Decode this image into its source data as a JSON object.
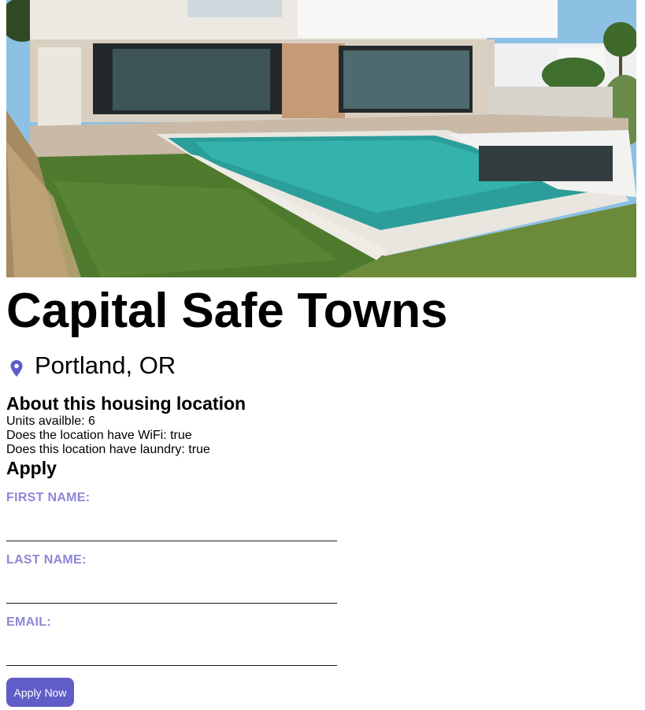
{
  "listing": {
    "name": "Capital Safe Towns",
    "city_state": "Portland, OR",
    "photo_icon": "house-photo"
  },
  "about": {
    "heading": "About this housing location",
    "units": "Units availble: 6",
    "wifi": "Does the location have WiFi: true",
    "laundry": "Does this location have laundry: true"
  },
  "apply": {
    "heading": "Apply",
    "first_name_label": "FIRST NAME:",
    "first_name_value": "",
    "last_name_label": "LAST NAME:",
    "last_name_value": "",
    "email_label": "EMAIL:",
    "email_value": "",
    "submit_label": "Apply Now"
  },
  "colors": {
    "accent": "#605dc8",
    "label": "#8c87d6"
  },
  "icons": {
    "location": "location-pin-icon"
  }
}
